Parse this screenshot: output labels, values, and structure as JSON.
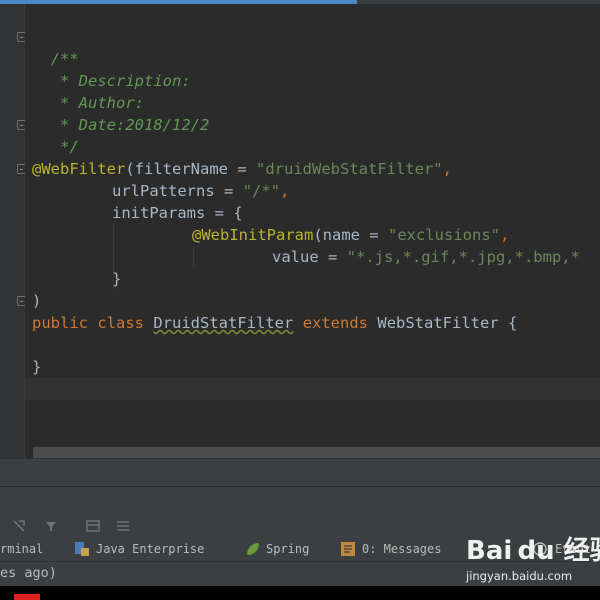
{
  "colors": {
    "background": "#2b2b2b",
    "comment": "#629755",
    "annotation": "#bbb529",
    "string": "#6a8759",
    "keyword": "#cc7832",
    "identifier": "#a9b7c6",
    "panel": "#3c3f41",
    "accent": "#4a88c7"
  },
  "editor": {
    "comment": {
      "open": "/**",
      "description": " * Description:",
      "author": " * Author:",
      "date": " * Date:2018/12/2",
      "close": " */"
    },
    "webfilter": {
      "annotation": "@WebFilter",
      "open_paren": "(",
      "filter_name_key": "filterName = ",
      "filter_name_value": "\"druidWebStatFilter\"",
      "comma1": ","
    },
    "url_patterns": {
      "key": "urlPatterns = ",
      "value": "\"/*\"",
      "comma": ","
    },
    "init_params": {
      "key": "initParams = {"
    },
    "webinitparam": {
      "annotation": "@WebInitParam",
      "open_paren": "(",
      "name_key": "name = ",
      "name_value": "\"exclusions\"",
      "comma": ","
    },
    "value_line": {
      "key": "value = ",
      "value": "\"*.js,*.gif,*.jpg,*.bmp,*"
    },
    "close_brace_inner": "}",
    "close_paren": ")",
    "class_decl": {
      "kw_public": "public",
      "kw_class": "class",
      "class_name": "DruidStatFilter",
      "kw_extends": "extends",
      "super_class": "WebStatFilter",
      "open_brace": "{"
    },
    "close_brace_class": "}"
  },
  "tool_tabs": [
    {
      "label": "rminal",
      "icon": "terminal-icon"
    },
    {
      "label": "Java Enterprise",
      "icon": "java-enterprise-icon"
    },
    {
      "label": "Spring",
      "icon": "spring-leaf-icon"
    },
    {
      "label": "0: Messages",
      "icon": "messages-icon"
    },
    {
      "label": "Event",
      "icon": "event-log-icon"
    }
  ],
  "status": {
    "text": "es ago)"
  },
  "watermark": {
    "logo": "Bai du 经验",
    "url": "jingyan.baidu.com"
  }
}
